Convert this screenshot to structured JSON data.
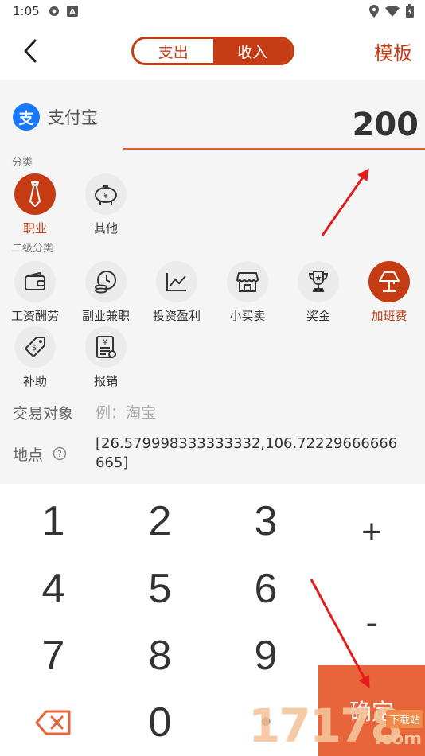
{
  "status_bar": {
    "time": "1:05",
    "left_icons": [
      "gear-icon",
      "a-letter-icon"
    ],
    "right_icons": [
      "location-icon",
      "wifi-icon",
      "battery-icon"
    ]
  },
  "header": {
    "tabs": [
      {
        "label": "支出",
        "active": false
      },
      {
        "label": "收入",
        "active": true
      }
    ],
    "template_label": "模板",
    "accent_color": "#c43b14"
  },
  "account": {
    "name": "支付宝",
    "icon": "alipay-icon",
    "icon_glyph": "支",
    "amount": "200"
  },
  "category": {
    "section_label": "分类",
    "items": [
      {
        "label": "职业",
        "icon": "tie-icon",
        "selected": true
      },
      {
        "label": "其他",
        "icon": "piggy-bank-icon",
        "selected": false
      }
    ]
  },
  "subcategory": {
    "section_label": "二级分类",
    "items": [
      {
        "label": "工资酬劳",
        "icon": "wallet-icon",
        "selected": false
      },
      {
        "label": "副业兼职",
        "icon": "coins-clock-icon",
        "selected": false
      },
      {
        "label": "投资盈利",
        "icon": "line-chart-icon",
        "selected": false
      },
      {
        "label": "小买卖",
        "icon": "shop-icon",
        "selected": false
      },
      {
        "label": "奖金",
        "icon": "trophy-icon",
        "selected": false
      },
      {
        "label": "加班费",
        "icon": "lamp-icon",
        "selected": true
      },
      {
        "label": "补助",
        "icon": "tag-icon",
        "selected": false
      },
      {
        "label": "报销",
        "icon": "receipt-icon",
        "selected": false
      }
    ]
  },
  "counterpart": {
    "label": "交易对象",
    "placeholder": "例：淘宝",
    "value": ""
  },
  "location": {
    "label": "地点",
    "value": "[26.579998333333332,106.72229666666665]"
  },
  "keypad": {
    "digits": [
      "1",
      "2",
      "3",
      "4",
      "5",
      "6",
      "7",
      "8",
      "9",
      "0"
    ],
    "plus": "+",
    "minus": "-",
    "dot": "•",
    "confirm": "确定",
    "backspace_icon": "backspace-icon"
  },
  "watermark": {
    "text": "17178",
    "domain_suffix": ".com",
    "badge": "下载站"
  }
}
